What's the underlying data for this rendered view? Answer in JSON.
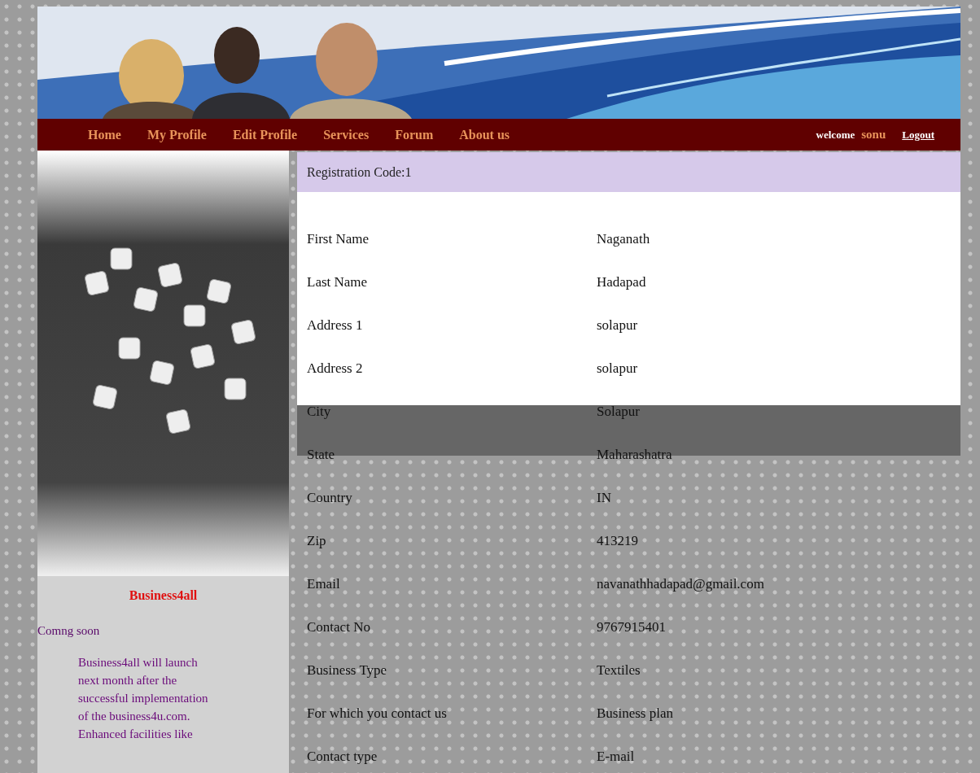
{
  "nav": {
    "items": [
      {
        "label": "Home"
      },
      {
        "label": "My Profile"
      },
      {
        "label": "Edit Profile"
      },
      {
        "label": "Services"
      },
      {
        "label": "Forum"
      },
      {
        "label": "About us"
      }
    ],
    "welcome": "welcome",
    "user": "sonu",
    "logout": "Logout"
  },
  "sidebar": {
    "title": "Business4all",
    "subtitle": "Comng soon",
    "lines": [
      "Business4all will launch",
      "next month after the",
      "successful implementation",
      "of the business4u.com.",
      "Enhanced facilities like"
    ]
  },
  "profile": {
    "header": "Registration Code:1",
    "rows": [
      {
        "label": "First Name",
        "value": "Naganath"
      },
      {
        "label": "Last Name",
        "value": "Hadapad"
      },
      {
        "label": "Address 1",
        "value": "solapur"
      },
      {
        "label": "Address 2",
        "value": "solapur"
      },
      {
        "label": "City",
        "value": "Solapur"
      },
      {
        "label": "State",
        "value": "Maharashatra"
      },
      {
        "label": "Country",
        "value": "IN"
      },
      {
        "label": "Zip",
        "value": "413219"
      },
      {
        "label": "Email",
        "value": "navanathhadapad@gmail.com"
      },
      {
        "label": "Contact No",
        "value": "9767915401"
      },
      {
        "label": "Business Type",
        "value": "Textiles"
      },
      {
        "label": "For which you contact us",
        "value": "Business plan"
      },
      {
        "label": "Contact type",
        "value": "E-mail"
      }
    ]
  }
}
